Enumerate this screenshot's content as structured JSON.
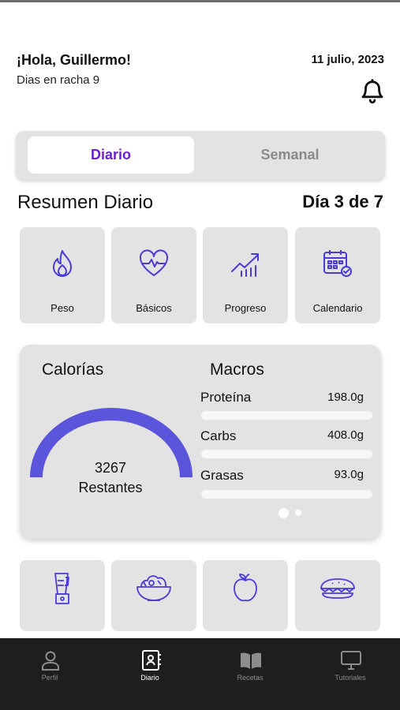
{
  "header": {
    "greeting": "¡Hola, Guillermo!",
    "streak": "Dias en racha 9",
    "date": "11 julio, 2023"
  },
  "segment": {
    "active": "Diario",
    "inactive": "Semanal"
  },
  "summary": {
    "title": "Resumen Diario",
    "day": "Día 3 de 7"
  },
  "quick_actions": [
    {
      "label": "Peso",
      "icon": "flame-icon"
    },
    {
      "label": "Básicos",
      "icon": "heart-pulse-icon"
    },
    {
      "label": "Progreso",
      "icon": "chart-up-icon"
    },
    {
      "label": "Calendario",
      "icon": "calendar-check-icon"
    }
  ],
  "calories": {
    "title": "Calorías",
    "value": "3267",
    "label": "Restantes"
  },
  "macros": {
    "title": "Macros",
    "items": [
      {
        "name": "Proteína",
        "value": "198.0g"
      },
      {
        "name": "Carbs",
        "value": "408.0g"
      },
      {
        "name": "Grasas",
        "value": "93.0g"
      }
    ]
  },
  "food_tiles": [
    "blender-icon",
    "salad-icon",
    "apple-icon",
    "sandwich-icon"
  ],
  "nav": [
    {
      "label": "Perfil",
      "icon": "user-icon"
    },
    {
      "label": "Diario",
      "icon": "journal-icon"
    },
    {
      "label": "Recetas",
      "icon": "book-icon"
    },
    {
      "label": "Tutoriales",
      "icon": "monitor-icon"
    }
  ],
  "colors": {
    "accent": "#6a1fd0",
    "icon": "#4b3bd6",
    "gauge": "#5b55dc",
    "card": "#e3e3e3",
    "navbar": "#1e1e1e"
  }
}
